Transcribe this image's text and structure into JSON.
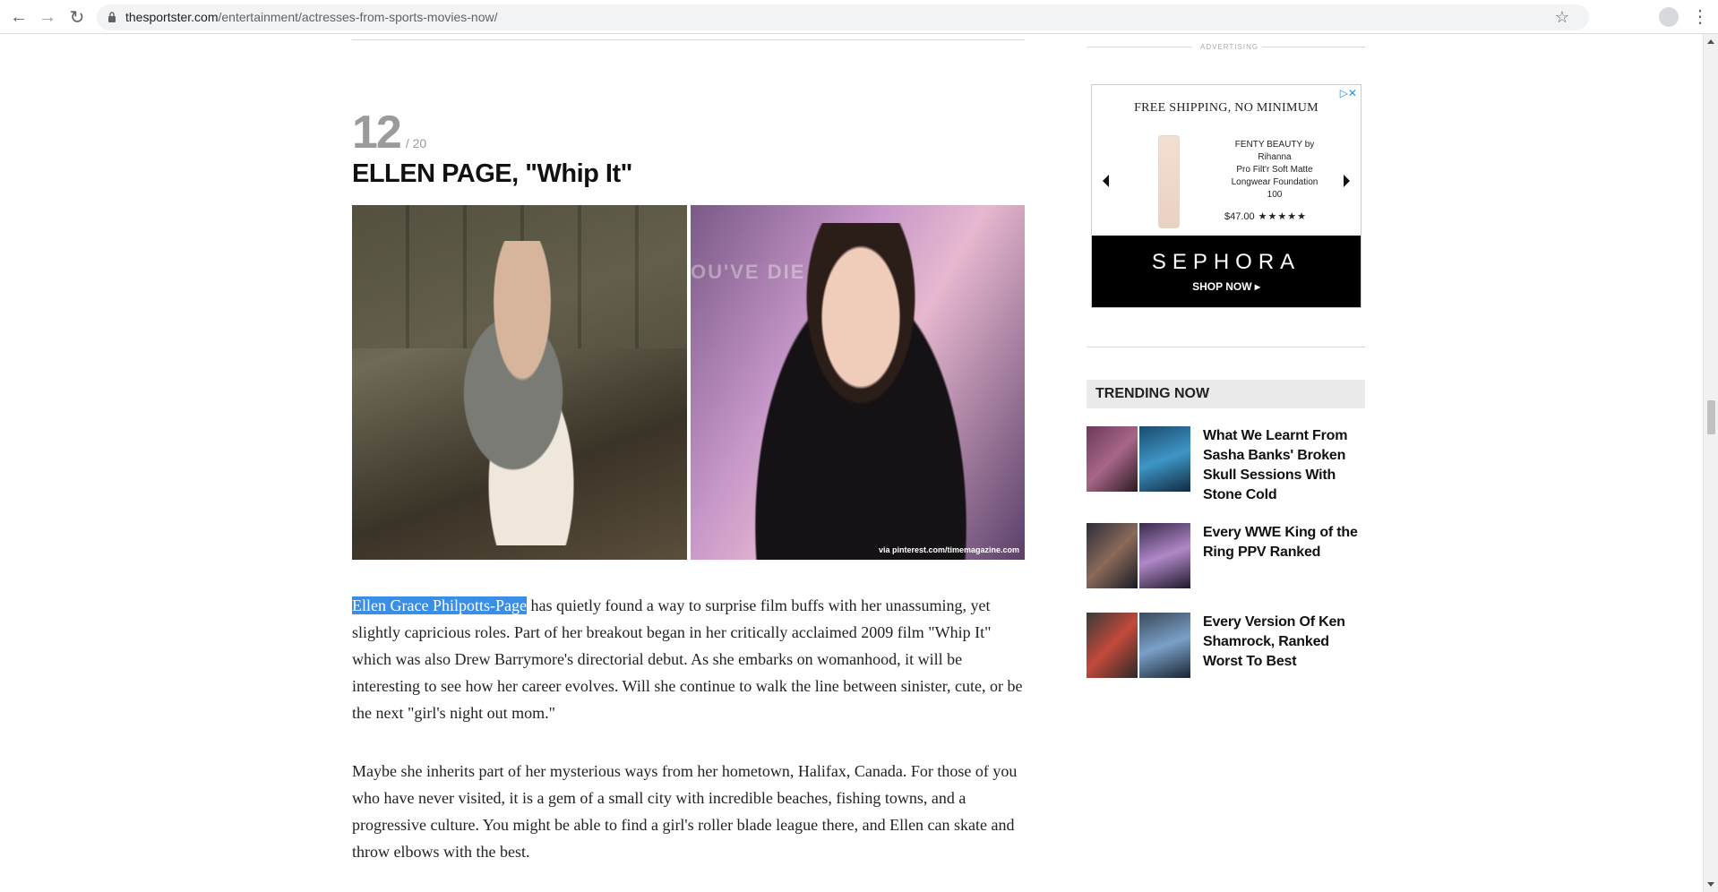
{
  "browser": {
    "url_domain": "thesportster.com",
    "url_path": "/entertainment/actresses-from-sports-movies-now/"
  },
  "article": {
    "counter_current": "12",
    "counter_total": "/ 20",
    "title": "ELLEN PAGE, \"Whip It\"",
    "photo_bg_text": "OU'VE DIE",
    "photo_credit": "via pinterest.com/timemagazine.com",
    "p1_selected": "Ellen Grace Philpotts-Page",
    "p1_rest": " has quietly found a way to surprise film buffs with her unassuming, yet slightly capricious roles. Part of her breakout began in her critically acclaimed 2009 film \"Whip It\" which was also Drew Barrymore's directorial debut. As she embarks on womanhood, it will be interesting to see how her career evolves. Will she continue to walk the line between sinister, cute, or be the next \"girl's night out mom.\"",
    "p2": "Maybe she inherits part of her mysterious ways from her hometown, Halifax, Canada. For those of you who have never visited, it is a gem of a small city with incredible beaches, fishing towns, and a progressive culture. You might be able to find a girl's roller blade league there, and Ellen can skate and throw elbows with the best."
  },
  "ad": {
    "label": "ADVERTISING",
    "headline": "FREE SHIPPING, NO MINIMUM",
    "product_brand": "FENTY BEAUTY by Rihanna",
    "product_name": "Pro Filt'r Soft Matte Longwear Foundation",
    "product_shade": "100",
    "price": "$47.00",
    "stars": "★★★★★",
    "brand": "SEPHORA",
    "cta": "SHOP NOW ▸",
    "choice_icon": "▷✕"
  },
  "sidebar": {
    "trending_title": "TRENDING NOW",
    "items": [
      {
        "title": "What We Learnt From Sasha Banks' Broken Skull Sessions With Stone Cold"
      },
      {
        "title": "Every WWE King of the Ring PPV Ranked"
      },
      {
        "title": "Every Version Of Ken Shamrock, Ranked Worst To Best"
      }
    ]
  }
}
